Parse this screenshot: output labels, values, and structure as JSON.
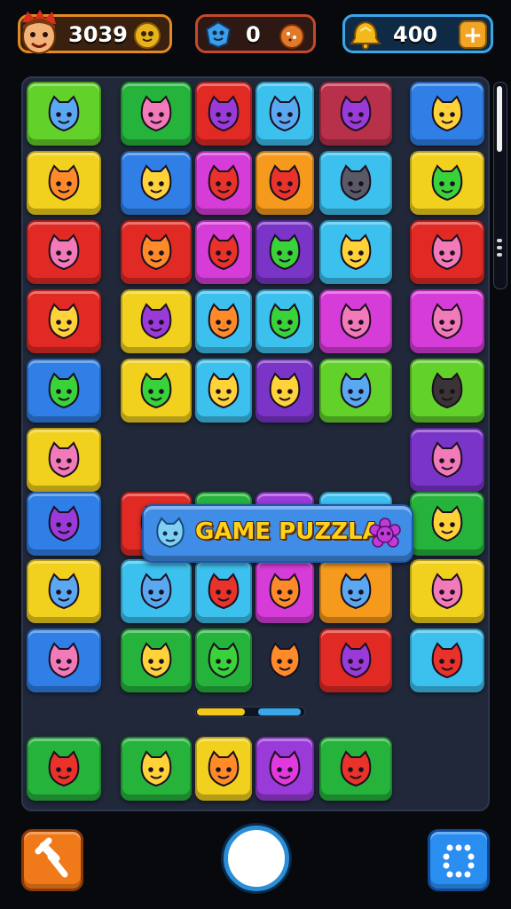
{
  "hud": {
    "score": "3039",
    "gems": "0",
    "coins": "400"
  },
  "banner": {
    "title": "GAME PUZZLA"
  },
  "progress": {
    "filled_fraction": 0.55,
    "segments": [
      "#f2c81a",
      "#2a3a58",
      "#3aa8e8"
    ]
  },
  "colors": {
    "score_border": "#e38a22",
    "gems_border": "#c24a2a",
    "coins_border": "#3aa8e8",
    "board_bg": "#20283a",
    "banner_bg": "#3f8de6",
    "banner_text": "#ffd21a"
  },
  "icons": {
    "score": "character-avatar-icon",
    "score_badge": "gold-face-icon",
    "gems": "blue-gem-icon",
    "gems_badge": "cookie-icon",
    "coins": "gold-bell-icon",
    "add": "plus-icon",
    "left_button": "hammer-icon",
    "center_button": "circle-icon",
    "right_button": "grid-dots-icon"
  },
  "board": {
    "tiles": [
      {
        "row": 0,
        "col": 0,
        "color": "lime",
        "creature": "blue-blob"
      },
      {
        "row": 0,
        "col": 1,
        "color": "green",
        "creature": "pink-cat"
      },
      {
        "row": 0,
        "col": 2,
        "color": "red",
        "creature": "purple-plum"
      },
      {
        "row": 0,
        "col": 3,
        "color": "cyan",
        "creature": "blue-star"
      },
      {
        "row": 0,
        "col": 4,
        "color": "wine",
        "creature": "purple-cat"
      },
      {
        "row": 0,
        "col": 5,
        "color": "blue",
        "creature": "yellow-blob"
      },
      {
        "row": 1,
        "col": 0,
        "color": "yellow",
        "creature": "orange-face"
      },
      {
        "row": 1,
        "col": 1,
        "color": "blue",
        "creature": "yellow-lemon"
      },
      {
        "row": 1,
        "col": 2,
        "color": "magenta",
        "creature": "red-berry"
      },
      {
        "row": 1,
        "col": 3,
        "color": "orange",
        "creature": "red-pepper"
      },
      {
        "row": 1,
        "col": 4,
        "color": "cyan",
        "creature": "gray-cat"
      },
      {
        "row": 1,
        "col": 5,
        "color": "yellow",
        "creature": "green-flower"
      },
      {
        "row": 2,
        "col": 0,
        "color": "red",
        "creature": "pink-bear"
      },
      {
        "row": 2,
        "col": 1,
        "color": "red",
        "creature": "orange-cat"
      },
      {
        "row": 2,
        "col": 2,
        "color": "magenta",
        "creature": "red-apple"
      },
      {
        "row": 2,
        "col": 3,
        "color": "purple",
        "creature": "green-pepper"
      },
      {
        "row": 2,
        "col": 4,
        "color": "cyan",
        "creature": "yellow-star"
      },
      {
        "row": 2,
        "col": 5,
        "color": "red",
        "creature": "pink-bear"
      },
      {
        "row": 3,
        "col": 0,
        "color": "red",
        "creature": "yellow-bear"
      },
      {
        "row": 3,
        "col": 1,
        "color": "yellow",
        "creature": "purple-candy"
      },
      {
        "row": 3,
        "col": 2,
        "color": "cyan",
        "creature": "orange-leaf"
      },
      {
        "row": 3,
        "col": 3,
        "color": "cyan",
        "creature": "green-pepper"
      },
      {
        "row": 3,
        "col": 4,
        "color": "magenta",
        "creature": "pink-cat"
      },
      {
        "row": 3,
        "col": 5,
        "color": "magenta",
        "creature": "pink-flower"
      },
      {
        "row": 4,
        "col": 0,
        "color": "blue",
        "creature": "green-bird"
      },
      {
        "row": 4,
        "col": 1,
        "color": "yellow",
        "creature": "green-apple"
      },
      {
        "row": 4,
        "col": 2,
        "color": "cyan",
        "creature": "yellow-lemon"
      },
      {
        "row": 4,
        "col": 3,
        "color": "purple",
        "creature": "yellow-mango"
      },
      {
        "row": 4,
        "col": 4,
        "color": "lime",
        "creature": "blue-fish"
      },
      {
        "row": 4,
        "col": 5,
        "color": "lime",
        "creature": "dark-blob"
      },
      {
        "row": 5,
        "col": 0,
        "color": "yellow",
        "creature": "pink-blob"
      },
      {
        "row": 5,
        "col": 5,
        "color": "purple",
        "creature": "pink-hat"
      },
      {
        "row": 6,
        "col": 0,
        "color": "blue",
        "creature": "purple-face"
      },
      {
        "row": 6,
        "col": 1,
        "color": "red",
        "creature": "green-apple"
      },
      {
        "row": 6,
        "col": 2,
        "color": "green",
        "creature": "blue-star"
      },
      {
        "row": 6,
        "col": 3,
        "color": "violet",
        "creature": "pink-radish"
      },
      {
        "row": 6,
        "col": 4,
        "color": "cyan",
        "creature": "yellow-bird"
      },
      {
        "row": 6,
        "col": 5,
        "color": "green",
        "creature": "yellow-fish"
      },
      {
        "row": 7,
        "col": 0,
        "color": "yellow",
        "creature": "blue-flower"
      },
      {
        "row": 7,
        "col": 1,
        "color": "cyan",
        "creature": "blue-blob"
      },
      {
        "row": 7,
        "col": 2,
        "color": "cyan",
        "creature": "red-spiky"
      },
      {
        "row": 7,
        "col": 3,
        "color": "magenta",
        "creature": "orange-pepper"
      },
      {
        "row": 7,
        "col": 4,
        "color": "orange",
        "creature": "blue-bird"
      },
      {
        "row": 7,
        "col": 5,
        "color": "yellow",
        "creature": "pink-flower"
      },
      {
        "row": 8,
        "col": 0,
        "color": "blue",
        "creature": "pink-cat"
      },
      {
        "row": 8,
        "col": 1,
        "color": "green",
        "creature": "yellow-square"
      },
      {
        "row": 8,
        "col": 2,
        "color": "green",
        "creature": "green-pepper"
      },
      {
        "row": 8,
        "col": 3,
        "color": "none",
        "creature": "orange-jar"
      },
      {
        "row": 8,
        "col": 4,
        "color": "red",
        "creature": "purple-bag"
      },
      {
        "row": 8,
        "col": 5,
        "color": "cyan",
        "creature": "red-heart"
      },
      {
        "row": 10,
        "col": 0,
        "color": "green",
        "creature": "red-blob"
      },
      {
        "row": 10,
        "col": 1,
        "color": "green",
        "creature": "yellow-bird"
      },
      {
        "row": 10,
        "col": 2,
        "color": "yellow",
        "creature": "orange-blob"
      },
      {
        "row": 10,
        "col": 3,
        "color": "violet",
        "creature": "magenta-fruit"
      },
      {
        "row": 10,
        "col": 4,
        "color": "green",
        "creature": "red-blob"
      }
    ]
  }
}
